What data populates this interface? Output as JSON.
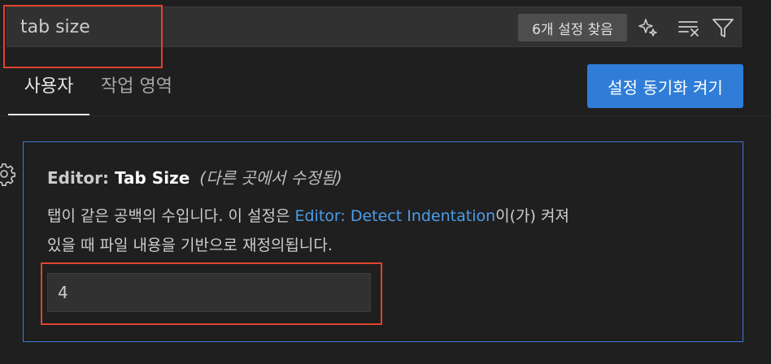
{
  "search": {
    "value": "tab size",
    "result_count": "6개 설정 찾음",
    "icons": [
      "sparkle-icon",
      "clear-filter-icon",
      "filter-icon"
    ]
  },
  "tabs": [
    {
      "label": "사용자",
      "active": true
    },
    {
      "label": "작업 영역",
      "active": false
    }
  ],
  "sync_button": {
    "label": "설정 동기화 켜기"
  },
  "setting": {
    "category": "Editor: ",
    "name": "Tab Size",
    "modified_note": "(다른 곳에서 수정됨)",
    "description_part1": "탭이 같은 공백의 수입니다. 이 설정은 ",
    "description_link": "Editor: Detect Indentation",
    "description_part2": "이(가) 켜져",
    "description_line2": "있을 때 파일 내용을 기반으로 재정의됩니다.",
    "value": "4"
  },
  "colors": {
    "accent": "#2f7dd7",
    "link": "#4c9de8",
    "highlight": "#e0432f",
    "card_border": "#3a7bd5"
  }
}
